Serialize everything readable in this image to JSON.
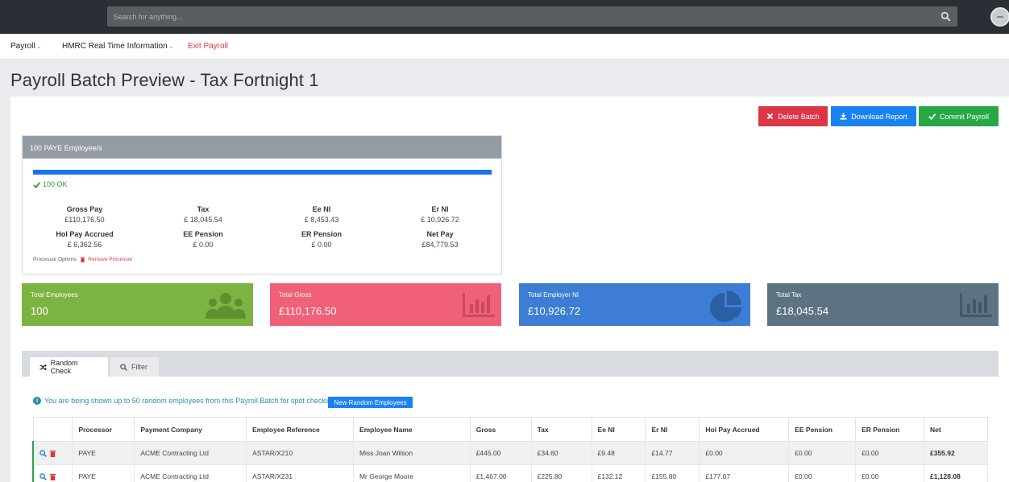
{
  "search": {
    "placeholder": "Search for anything..."
  },
  "menu": {
    "payroll": "Payroll",
    "hmrc": "HMRC Real Time Information",
    "exit": "Exit Payroll"
  },
  "page_title": "Payroll Batch Preview - Tax Fortnight 1",
  "actions": {
    "delete": "Delete Batch",
    "download": "Download Report",
    "commit": "Commit Payroll"
  },
  "batch": {
    "header": "100 PAYE Employee/s",
    "progress": 1.0,
    "ok_text": "100 OK",
    "stats": [
      {
        "label": "Gross Pay",
        "value": "£110,176.50"
      },
      {
        "label": "Tax",
        "value": "£ 18,045.54"
      },
      {
        "label": "Ee NI",
        "value": "£ 8,453.43"
      },
      {
        "label": "Er NI",
        "value": "£ 10,926.72"
      },
      {
        "label": "Hol Pay Accrued",
        "value": "£ 6,362.56"
      },
      {
        "label": "EE Pension",
        "value": "£ 0.00"
      },
      {
        "label": "ER Pension",
        "value": "£ 0.00"
      },
      {
        "label": "Net Pay",
        "value": "£84,779.53"
      }
    ],
    "processor_options": "Processor Options:",
    "remove_processor": "Remove Processor"
  },
  "tiles": [
    {
      "label": "Total Employees",
      "value": "100",
      "icon": "users-icon"
    },
    {
      "label": "Total Gross",
      "value": "£110,176.50",
      "icon": "bar-chart-icon"
    },
    {
      "label": "Total Employer NI",
      "value": "£10,926.72",
      "icon": "pie-chart-icon"
    },
    {
      "label": "Total Tax",
      "value": "£18,045.54",
      "icon": "bar-chart-icon"
    }
  ],
  "tabs": {
    "random": "Random Check",
    "filter": "Filter"
  },
  "info": {
    "text": "You are being shown up to 50 random employees from this Payroll Batch for spot checking.",
    "button": "New Random Employees"
  },
  "table": {
    "headers": [
      "",
      "Processor",
      "Payment Company",
      "Employee Reference",
      "Employee Name",
      "Gross",
      "Tax",
      "Ee NI",
      "Er NI",
      "Hol Pay Accrued",
      "EE Pension",
      "ER Pension",
      "Net"
    ],
    "rows": [
      [
        "PAYE",
        "ACME Contracting Ltd",
        "ASTAR/X210",
        "Miss Joan Wilson",
        "£445.00",
        "£34.60",
        "£9.48",
        "£14.77",
        "£0.00",
        "£0.00",
        "£0.00",
        "£355.92"
      ],
      [
        "PAYE",
        "ACME Contracting Ltd",
        "ASTAR/X231",
        "Mr George Moore",
        "£1,467.00",
        "£225.80",
        "£132.12",
        "£155.80",
        "£177.07",
        "£0.00",
        "£0.00",
        "£1,128.08"
      ]
    ]
  }
}
